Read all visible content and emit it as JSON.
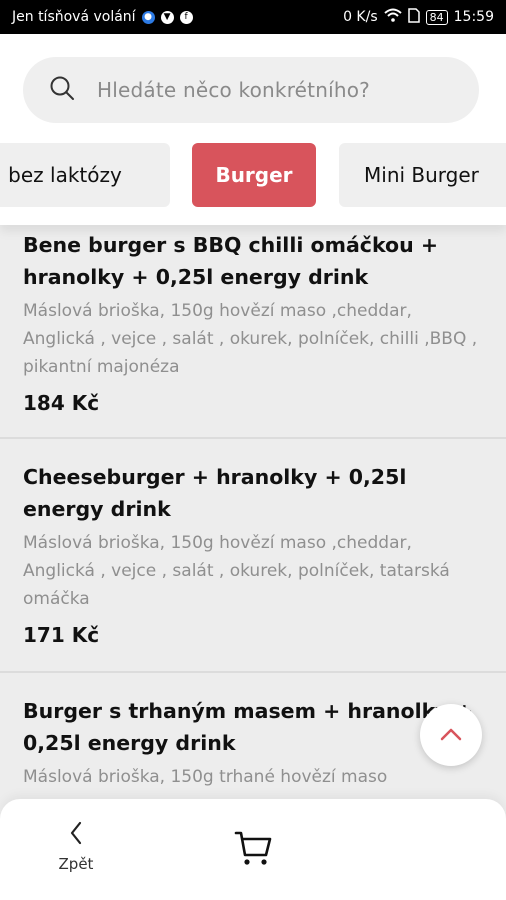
{
  "status_bar": {
    "carrier": "Jen tísňová volání",
    "speed": "0 K/s",
    "battery": "84",
    "time": "15:59"
  },
  "search": {
    "placeholder": "Hledáte něco konkrétního?"
  },
  "categories": [
    {
      "label": "bez laktózy",
      "selected": false
    },
    {
      "label": "Burger",
      "selected": true
    },
    {
      "label": "Mini Burger",
      "selected": false
    }
  ],
  "colors": {
    "accent": "#d8545c",
    "background": "#ededed"
  },
  "items": [
    {
      "title": "Bene burger s BBQ chilli omáčkou + hranolky + 0,25l energy drink",
      "description": "Máslová brioška, 150g hovězí maso ,cheddar, Anglická , vejce , salát , okurek, polníček, chilli ,BBQ , pikantní majonéza",
      "price": "184 Kč"
    },
    {
      "title": "Cheeseburger + hranolky + 0,25l energy drink",
      "description": "Máslová brioška, 150g hovězí maso ,cheddar, Anglická , vejce , salát , okurek, polníček, tatarská omáčka",
      "price": "171 Kč"
    },
    {
      "title": "Burger s trhaným masem + hranolky + 0,25l energy drink",
      "description": "Máslová brioška, 150g trhané hovězí maso",
      "price": ""
    }
  ],
  "bottom_nav": {
    "back_label": "Zpět"
  },
  "icons": {
    "search": "search-icon",
    "scroll_top": "chevron-up-icon",
    "back": "chevron-left-icon",
    "cart": "cart-icon"
  }
}
